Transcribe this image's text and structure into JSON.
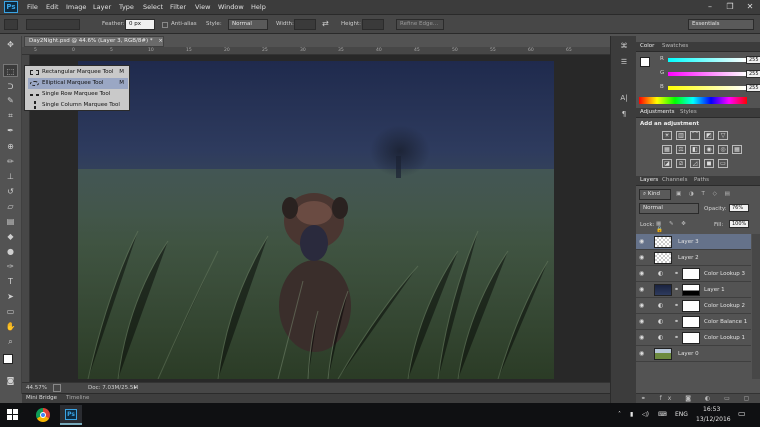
{
  "app": {
    "logo": "Ps"
  },
  "menu": [
    "File",
    "Edit",
    "Image",
    "Layer",
    "Type",
    "Select",
    "Filter",
    "View",
    "Window",
    "Help"
  ],
  "options": {
    "feather_label": "Feather:",
    "feather_value": "0 px",
    "antialias_label": "Anti-alias",
    "style_label": "Style:",
    "style_value": "Normal",
    "width_label": "Width:",
    "height_label": "Height:",
    "refine_edge": "Refine Edge...",
    "workspace": "Essentials"
  },
  "document": {
    "tab_title": "Day2Night.psd @ 44.6% (Layer 3, RGB/8#) *",
    "close": "×"
  },
  "ruler_ticks": [
    "5",
    "0",
    "5",
    "10",
    "15",
    "20",
    "25",
    "30",
    "35",
    "40",
    "45",
    "50",
    "55",
    "60",
    "65"
  ],
  "flyout": [
    {
      "label": "Rectangular Marquee Tool",
      "shortcut": "M"
    },
    {
      "label": "Elliptical Marquee Tool",
      "shortcut": "M"
    },
    {
      "label": "Single Row Marquee Tool",
      "shortcut": ""
    },
    {
      "label": "Single Column Marquee Tool",
      "shortcut": ""
    }
  ],
  "status": {
    "zoom": "44.57%",
    "doc": "Doc: 7.03M/25.5M"
  },
  "bottom_tabs": [
    "Mini Bridge",
    "Timeline"
  ],
  "color_panel": {
    "tabs": [
      "Color",
      "Swatches"
    ],
    "r_label": "R",
    "g_label": "G",
    "b_label": "B",
    "r": "255",
    "g": "255",
    "b": "255"
  },
  "adjustments": {
    "tabs": [
      "Adjustments",
      "Styles"
    ],
    "heading": "Add an adjustment"
  },
  "layers_panel": {
    "tabs": [
      "Layers",
      "Channels",
      "Paths"
    ],
    "kind": "Kind",
    "blend": "Normal",
    "opacity_label": "Opacity:",
    "opacity": "76%",
    "lock_label": "Lock:",
    "fill_label": "Fill:",
    "fill": "100%",
    "layers": [
      {
        "name": "Layer 3",
        "selected": true,
        "type": "pixel-empty"
      },
      {
        "name": "Layer 2",
        "selected": false,
        "type": "pixel-empty"
      },
      {
        "name": "Color Lookup 3",
        "selected": false,
        "type": "adjustment"
      },
      {
        "name": "Layer 1",
        "selected": false,
        "type": "pixel-dark"
      },
      {
        "name": "Color Lookup 2",
        "selected": false,
        "type": "adjustment"
      },
      {
        "name": "Color Balance 1",
        "selected": false,
        "type": "adjustment"
      },
      {
        "name": "Color Lookup 1",
        "selected": false,
        "type": "adjustment"
      },
      {
        "name": "Layer 0",
        "selected": false,
        "type": "photo"
      }
    ]
  },
  "taskbar": {
    "lang": "ENG",
    "time": "16:53",
    "date": "13/12/2016"
  },
  "colors": {
    "selection": "#65728a",
    "accent": "#3aa3e3"
  }
}
